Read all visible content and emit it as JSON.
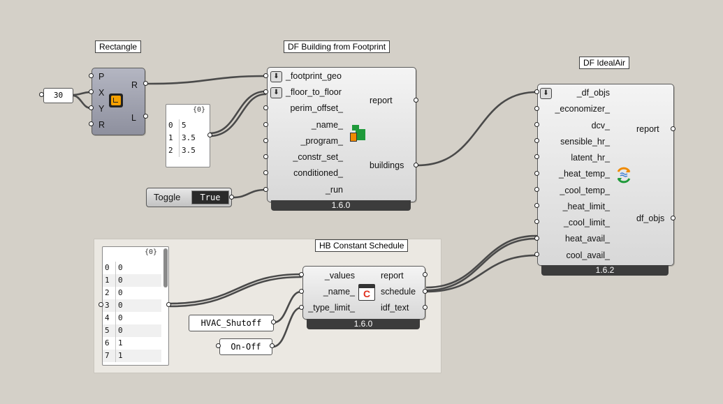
{
  "colors": {
    "canvas": "#d4d0c8",
    "wire": "#4a4a4a",
    "version_bar": "#3c3c3c"
  },
  "rectangle": {
    "title": "Rectangle",
    "inputs": [
      "P",
      "X",
      "Y",
      "R"
    ],
    "outputs": [
      "R",
      "L"
    ],
    "icon": "rectangle-icon"
  },
  "number_slider": {
    "value": "30"
  },
  "floor_panel": {
    "header": "{0}",
    "rows": [
      [
        "0",
        "5"
      ],
      [
        "1",
        "3.5"
      ],
      [
        "2",
        "3.5"
      ]
    ]
  },
  "toggle": {
    "label": "Toggle",
    "value": "True"
  },
  "df_building": {
    "title": "DF Building from Footprint",
    "inputs": [
      "_footprint_geo",
      "_floor_to_floor",
      "perim_offset_",
      "_name_",
      "_program_",
      "_constr_set_",
      "conditioned_",
      "_run"
    ],
    "outputs": [
      "report",
      "buildings"
    ],
    "version": "1.6.0",
    "icon": "building-icon"
  },
  "df_idealair": {
    "title": "DF IdealAir",
    "inputs": [
      "_df_objs",
      "_economizer_",
      "dcv_",
      "sensible_hr_",
      "latent_hr_",
      "_heat_temp_",
      "_cool_temp_",
      "_heat_limit_",
      "_cool_limit_",
      "heat_avail_",
      "cool_avail_"
    ],
    "outputs": [
      "report",
      "df_objs"
    ],
    "version": "1.6.2",
    "icon": "idealair-icon"
  },
  "values_panel": {
    "header": "{0}",
    "rows": [
      [
        "0",
        "0"
      ],
      [
        "1",
        "0"
      ],
      [
        "2",
        "0"
      ],
      [
        "3",
        "0"
      ],
      [
        "4",
        "0"
      ],
      [
        "5",
        "0"
      ],
      [
        "6",
        "1"
      ],
      [
        "7",
        "1"
      ]
    ]
  },
  "hb_schedule": {
    "title": "HB Constant Schedule",
    "inputs": [
      "_values",
      "_name_",
      "_type_limit_"
    ],
    "outputs": [
      "report",
      "schedule",
      "idf_text"
    ],
    "version": "1.6.0",
    "icon": "calendar-icon",
    "icon_letter": "C"
  },
  "name_string": {
    "value": "HVAC_Shutoff"
  },
  "type_string": {
    "value": "On-Off"
  }
}
